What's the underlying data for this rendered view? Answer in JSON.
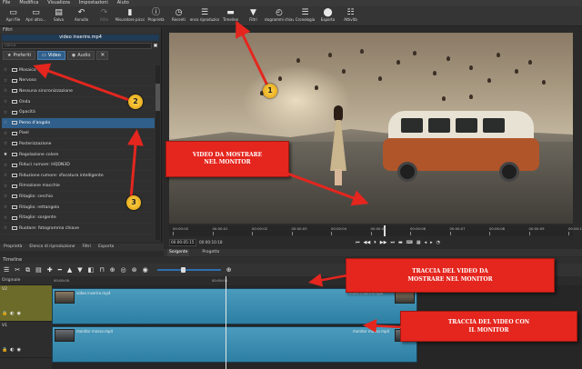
{
  "menu": [
    "File",
    "Modifica",
    "Visualizza",
    "Impostazioni",
    "Aiuto"
  ],
  "toolbar": [
    {
      "label": "Apri file",
      "icon": "folder-icon",
      "glyph": "▭"
    },
    {
      "label": "Apri altro...",
      "icon": "folder-open-icon",
      "glyph": "▭"
    },
    {
      "label": "Salva",
      "icon": "save-icon",
      "glyph": "▤"
    },
    {
      "label": "Annulla",
      "icon": "undo-icon",
      "glyph": "↶"
    },
    {
      "label": "Rifai",
      "icon": "redo-icon",
      "glyph": "↷",
      "disabled": true
    },
    {
      "label": "Misuratore picco",
      "icon": "peak-meter-icon",
      "glyph": "▮"
    },
    {
      "label": "Proprietà",
      "icon": "info-icon",
      "glyph": "ⓘ"
    },
    {
      "label": "Recenti",
      "icon": "clock-icon",
      "glyph": "◷"
    },
    {
      "label": "Elenco riproduzione",
      "icon": "playlist-icon",
      "glyph": "☰"
    },
    {
      "label": "Timeline",
      "icon": "timeline-icon",
      "glyph": "▬"
    },
    {
      "label": "Filtri",
      "icon": "filter-icon",
      "glyph": "▼"
    },
    {
      "label": "Fotogrammi chiave",
      "icon": "keyframes-icon",
      "glyph": "◴"
    },
    {
      "label": "Cronologia",
      "icon": "history-icon",
      "glyph": "☰"
    },
    {
      "label": "Esporta",
      "icon": "export-icon",
      "glyph": "⬤"
    },
    {
      "label": "Attività",
      "icon": "jobs-icon",
      "glyph": "☷"
    }
  ],
  "filters": {
    "title": "Filtri",
    "clip_name": "video inserire.mp4",
    "search_placeholder": "cerca",
    "tabs": {
      "favorites": "Preferiti",
      "video": "Video",
      "audio": "Audio"
    },
    "items": [
      {
        "label": "Mosaico",
        "fav": false
      },
      {
        "label": "Nervoso",
        "fav": false
      },
      {
        "label": "Nessuna sincronizzazione",
        "fav": false
      },
      {
        "label": "Onda",
        "fav": false
      },
      {
        "label": "Opacità",
        "fav": false
      },
      {
        "label": "Perno d'angolo",
        "fav": false,
        "selected": true
      },
      {
        "label": "Pixel",
        "fav": false
      },
      {
        "label": "Posterizzazione",
        "fav": false
      },
      {
        "label": "Regolazione colore",
        "fav": true
      },
      {
        "label": "Riduci rumore: HQDN3D",
        "fav": false
      },
      {
        "label": "Riduzione rumore: sfocatura intelligente",
        "fav": false
      },
      {
        "label": "Rimozione macchie",
        "fav": false
      },
      {
        "label": "Ritaglio: cerchio",
        "fav": false
      },
      {
        "label": "Ritaglio: rettangolo",
        "fav": false
      },
      {
        "label": "Ritaglio: sorgente",
        "fav": false
      },
      {
        "label": "Ruotare: fotogramma chiave",
        "fav": false
      }
    ]
  },
  "player": {
    "annotation": "VIDEO DA MOSTRARE\nNEL MONITOR",
    "ruler_labels": [
      "00:00:00",
      "00:00:01",
      "00:00:02",
      "00:00:03",
      "00:00:04",
      "00:00:05",
      "00:00:06",
      "00:00:07",
      "00:00:08",
      "00:00:09",
      "00:00:10"
    ],
    "timecode": "00:00:05:15",
    "total": "00:00:10:18",
    "controls": [
      "⏮",
      "◀◀",
      "⏵",
      "▶▶",
      "⏭",
      "▬",
      "⌨",
      "▦",
      "◂",
      "▸",
      "◔"
    ],
    "tabs": [
      "Sorgente",
      "Progetto"
    ]
  },
  "bottom_tabs_left": [
    "Proprietà",
    "Elenco di riproduzione",
    "Filtri",
    "Esporta"
  ],
  "timeline": {
    "title": "Timeline",
    "tool_icons": [
      "☰",
      "✂",
      "⧉",
      "▤",
      "✚",
      "━",
      "▲",
      "▼",
      "◧",
      "⊓",
      "⊕",
      "◎",
      "⊛",
      "◉"
    ],
    "ruler_labels": [
      "00:00:00",
      "00:00:05",
      "00:00:10"
    ],
    "master": "Originale",
    "tracks": [
      {
        "name": "V2",
        "clip": "video inserire.mp4",
        "selected": true
      },
      {
        "name": "V1",
        "clip": "monitor mosso.mp4",
        "selected": false
      }
    ],
    "annotation_top": "TRACCIA DEL VIDEO DA\nMOSTRARE NEL MONITOR",
    "annotation_bottom": "TRACCIA DEL VIDEO CON\nIL MONITOR"
  },
  "badges": [
    "1",
    "2",
    "3"
  ],
  "colors": {
    "accent": "#2f5f8a",
    "annotation": "#e4261e",
    "clip": "#3a8db3",
    "track_selected": "#6d6b2a"
  }
}
